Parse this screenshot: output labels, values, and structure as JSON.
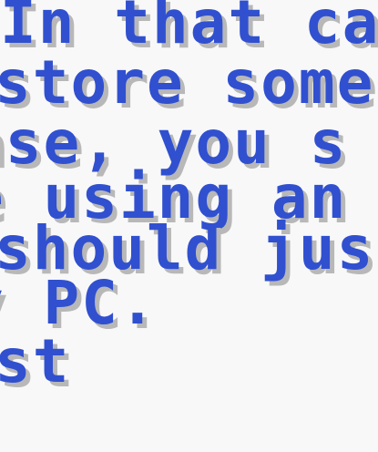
{
  "dialog": {
    "lines": [
      "In that ca",
      "store some",
      "ase, you s",
      "e using an",
      "should jus",
      "y PC.",
      "st"
    ]
  },
  "colors": {
    "background": "#f8f8f8",
    "text": "#3050d0",
    "shadow": "#b8b8b8"
  }
}
